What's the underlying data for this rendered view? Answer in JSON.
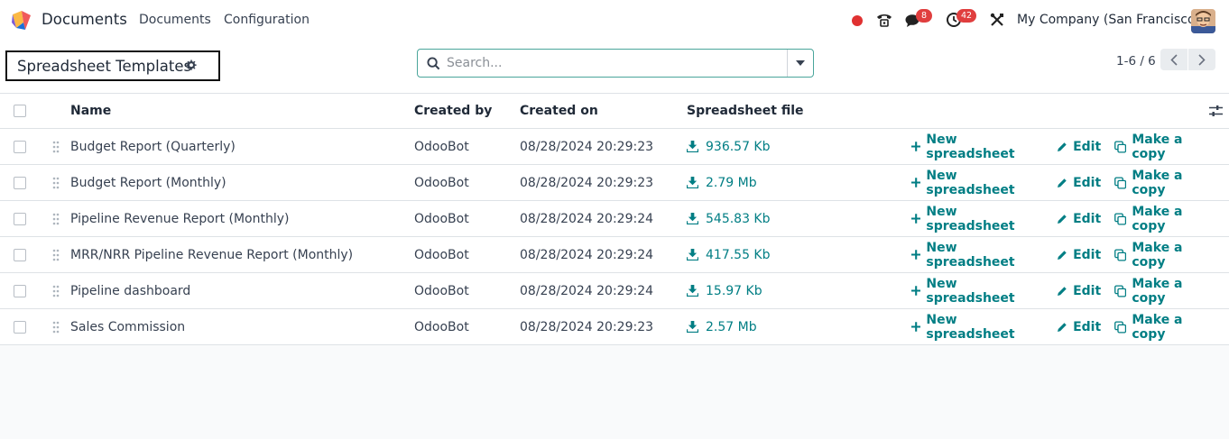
{
  "navbar": {
    "app_name": "Documents",
    "menu": [
      {
        "label": "Documents"
      },
      {
        "label": "Configuration"
      }
    ],
    "recording_color": "#e03131",
    "messages_badge": "8",
    "activities_badge": "42",
    "company": "My Company (San Francisco)"
  },
  "control_panel": {
    "title": "Spreadsheet Templates",
    "search": {
      "placeholder": "Search..."
    },
    "pager": {
      "value": "1-6 / 6"
    }
  },
  "table": {
    "columns": {
      "name": "Name",
      "created_by": "Created by",
      "created_on": "Created on",
      "file": "Spreadsheet file"
    },
    "actions": {
      "new": "New spreadsheet",
      "edit": "Edit",
      "copy": "Make a copy"
    },
    "rows": [
      {
        "name": "Budget Report (Quarterly)",
        "created_by": "OdooBot",
        "created_on": "08/28/2024 20:29:23",
        "file": "936.57 Kb"
      },
      {
        "name": "Budget Report (Monthly)",
        "created_by": "OdooBot",
        "created_on": "08/28/2024 20:29:23",
        "file": "2.79 Mb"
      },
      {
        "name": "Pipeline Revenue Report (Monthly)",
        "created_by": "OdooBot",
        "created_on": "08/28/2024 20:29:24",
        "file": "545.83 Kb"
      },
      {
        "name": "MRR/NRR Pipeline Revenue Report (Monthly)",
        "created_by": "OdooBot",
        "created_on": "08/28/2024 20:29:24",
        "file": "417.55 Kb"
      },
      {
        "name": "Pipeline dashboard",
        "created_by": "OdooBot",
        "created_on": "08/28/2024 20:29:24",
        "file": "15.97 Kb"
      },
      {
        "name": "Sales Commission",
        "created_by": "OdooBot",
        "created_on": "08/28/2024 20:29:23",
        "file": "2.57 Mb"
      }
    ]
  },
  "colors": {
    "accent": "#017e84",
    "badge": "#e03e3e",
    "search_border": "#4aa59b"
  }
}
